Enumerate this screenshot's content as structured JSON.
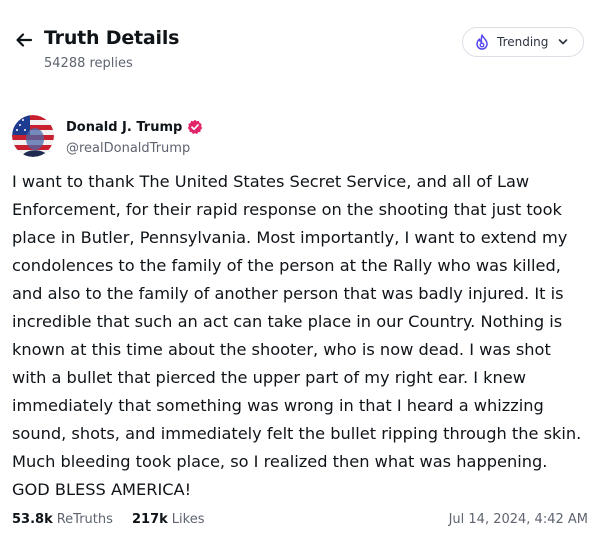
{
  "header": {
    "back_icon": "arrow-left-icon",
    "title": "Truth Details",
    "reply_count": "54288 replies",
    "trending": {
      "icon": "fire-icon",
      "label": "Trending",
      "chevron_icon": "chevron-down-icon",
      "accent_color": "#5448ee"
    }
  },
  "post": {
    "author": {
      "display_name": "Donald J. Trump",
      "handle": "@realDonaldTrump",
      "verified_icon": "verified-badge-icon",
      "verified_color": "#e2246a"
    },
    "body": "I want to thank The United States Secret Service, and all of Law Enforcement, for their rapid response on the shooting that just took place in Butler, Pennsylvania. Most importantly, I want to extend my condolences to the family of the person at the Rally who was killed, and also to the family of another person that was badly injured. It is incredible that such an act can take place in our Country. Nothing is known at this time about the shooter, who is now dead. I was shot with a bullet that pierced the upper part of my right ear. I knew immediately that something was wrong in that I heard a whizzing sound, shots, and immediately felt the bullet ripping through the skin. Much bleeding took place, so I realized then what was happening. GOD BLESS AMERICA!",
    "stats": {
      "retruths_count": "53.8k",
      "retruths_label": "ReTruths",
      "likes_count": "217k",
      "likes_label": "Likes"
    },
    "timestamp": "Jul 14, 2024, 4:42 AM"
  }
}
